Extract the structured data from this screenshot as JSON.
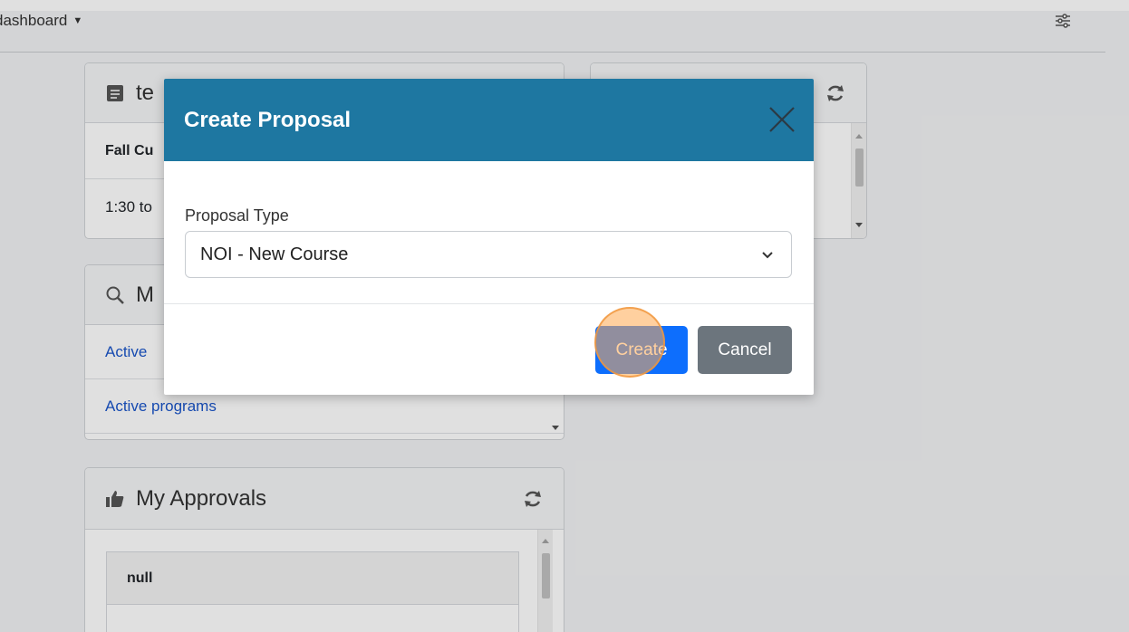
{
  "header": {
    "dashboard_label": "dashboard",
    "caret": "▼",
    "settings_icon": "sliders-icon"
  },
  "cards": {
    "events": {
      "title": "te",
      "icon": "document-icon",
      "rows": [
        "Fall Cu",
        "1:30 to"
      ]
    },
    "right_top": {
      "icon": "refresh-icon"
    },
    "my_search": {
      "title": "M",
      "icon": "search-icon",
      "links": [
        "Active",
        "Active programs"
      ]
    },
    "my_approvals": {
      "title": "My Approvals",
      "icon": "thumbs-up-icon",
      "rows": [
        "null"
      ]
    }
  },
  "modal": {
    "title": "Create Proposal",
    "field_label": "Proposal Type",
    "selected_value": "NOI - New Course",
    "create_label": "Create",
    "cancel_label": "Cancel"
  },
  "colors": {
    "modal_header": "#1e77a1",
    "primary": "#0d6efd",
    "secondary": "#6c757d",
    "link": "#1a55c9"
  }
}
